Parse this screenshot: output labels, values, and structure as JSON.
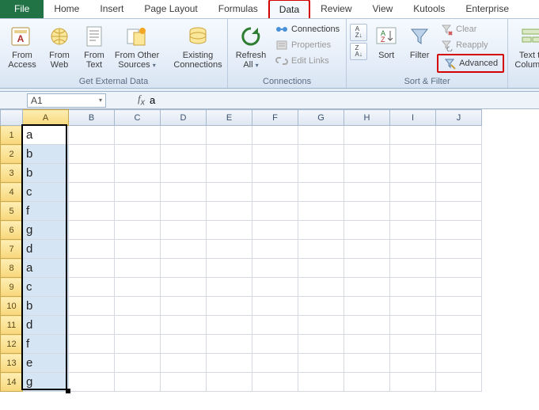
{
  "tabs": {
    "file": "File",
    "list": [
      "Home",
      "Insert",
      "Page Layout",
      "Formulas",
      "Data",
      "Review",
      "View",
      "Kutools",
      "Enterprise"
    ],
    "active_index": 4
  },
  "ribbon": {
    "get_external": {
      "label": "Get External Data",
      "from_access": "From\nAccess",
      "from_web": "From\nWeb",
      "from_text": "From\nText",
      "from_other": "From Other\nSources",
      "existing": "Existing\nConnections"
    },
    "connections": {
      "label": "Connections",
      "refresh": "Refresh\nAll",
      "conn": "Connections",
      "props": "Properties",
      "edit_links": "Edit Links"
    },
    "sort_filter": {
      "label": "Sort & Filter",
      "sort_asc": "A→Z",
      "sort_desc": "Z→A",
      "sort": "Sort",
      "filter": "Filter",
      "clear": "Clear",
      "reapply": "Reapply",
      "advanced": "Advanced"
    },
    "data_tools": {
      "text_to_columns": "Text to\nColumns"
    }
  },
  "namebox": {
    "value": "A1"
  },
  "formula": {
    "value": "a"
  },
  "grid": {
    "columns": [
      "A",
      "B",
      "C",
      "D",
      "E",
      "F",
      "G",
      "H",
      "I",
      "J"
    ],
    "rows": [
      {
        "n": 1,
        "v": "a"
      },
      {
        "n": 2,
        "v": "b"
      },
      {
        "n": 3,
        "v": "b"
      },
      {
        "n": 4,
        "v": "c"
      },
      {
        "n": 5,
        "v": "f"
      },
      {
        "n": 6,
        "v": "g"
      },
      {
        "n": 7,
        "v": "d"
      },
      {
        "n": 8,
        "v": "a"
      },
      {
        "n": 9,
        "v": "c"
      },
      {
        "n": 10,
        "v": "b"
      },
      {
        "n": 11,
        "v": "d"
      },
      {
        "n": 12,
        "v": "f"
      },
      {
        "n": 13,
        "v": "e"
      },
      {
        "n": 14,
        "v": "g"
      }
    ],
    "selected_col": 0,
    "active_row": 0,
    "sel_rows": 14
  }
}
